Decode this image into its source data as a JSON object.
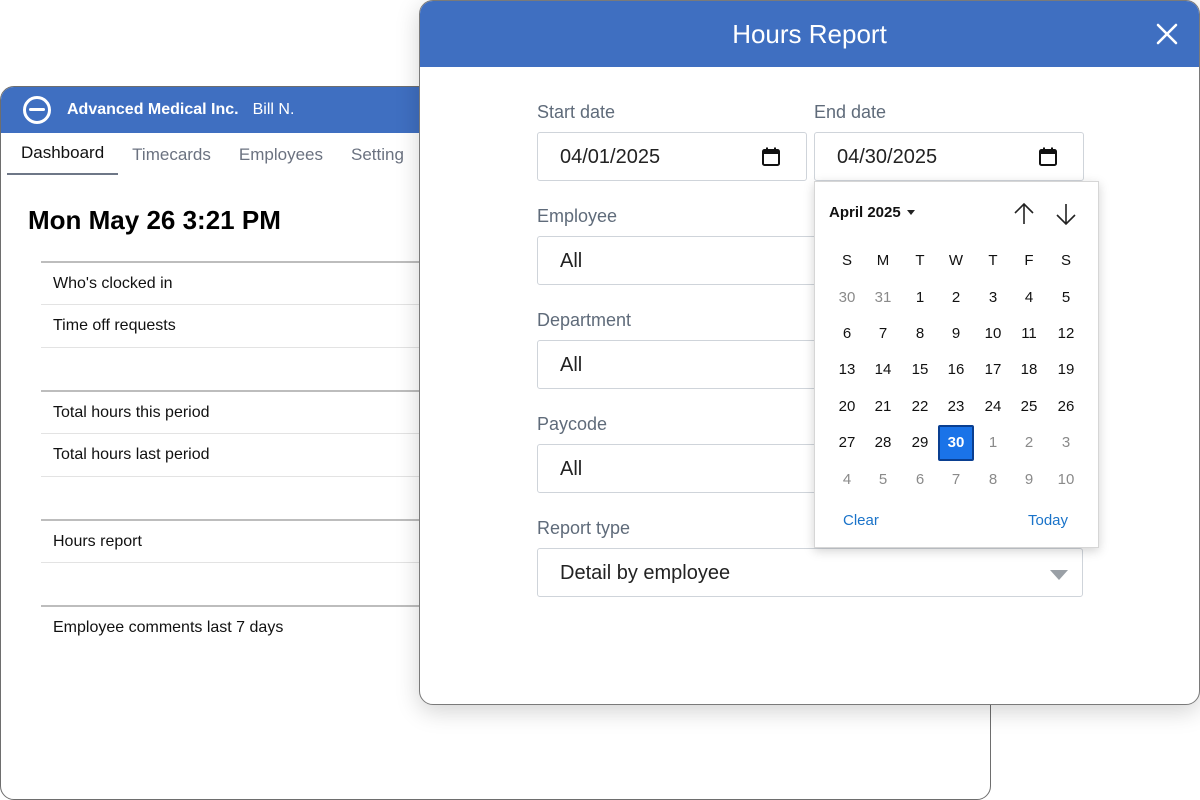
{
  "app": {
    "company": "Advanced Medical Inc.",
    "user": "Bill N.",
    "tabs": [
      "Dashboard",
      "Timecards",
      "Employees",
      "Setting"
    ],
    "datetime": "Mon May 26 3:21 PM",
    "list": [
      "Who's clocked in",
      "Time off requests",
      "Total hours this period",
      "Total hours last period",
      "Hours report",
      "Employee comments last 7 days"
    ]
  },
  "modal": {
    "title": "Hours Report",
    "start_date": {
      "label": "Start date",
      "value": "04/01/2025"
    },
    "end_date": {
      "label": "End date",
      "value": "04/30/2025"
    },
    "employee": {
      "label": "Employee",
      "value": "All"
    },
    "department": {
      "label": "Department",
      "value": "All"
    },
    "paycode": {
      "label": "Paycode",
      "value": "All"
    },
    "report_type": {
      "label": "Report type",
      "value": "Detail by employee"
    }
  },
  "calendar": {
    "month": "April 2025",
    "weekdays": [
      "S",
      "M",
      "T",
      "W",
      "T",
      "F",
      "S"
    ],
    "weeks": [
      [
        "30",
        "31",
        "1",
        "2",
        "3",
        "4",
        "5"
      ],
      [
        "6",
        "7",
        "8",
        "9",
        "10",
        "11",
        "12"
      ],
      [
        "13",
        "14",
        "15",
        "16",
        "17",
        "18",
        "19"
      ],
      [
        "20",
        "21",
        "22",
        "23",
        "24",
        "25",
        "26"
      ],
      [
        "27",
        "28",
        "29",
        "30",
        "1",
        "2",
        "3"
      ],
      [
        "4",
        "5",
        "6",
        "7",
        "8",
        "9",
        "10"
      ]
    ],
    "selected": "30",
    "clear_label": "Clear",
    "today_label": "Today"
  },
  "colors": {
    "header": "#3f6fc1",
    "selected_day": "#1a73e8",
    "link": "#1a73c9"
  }
}
